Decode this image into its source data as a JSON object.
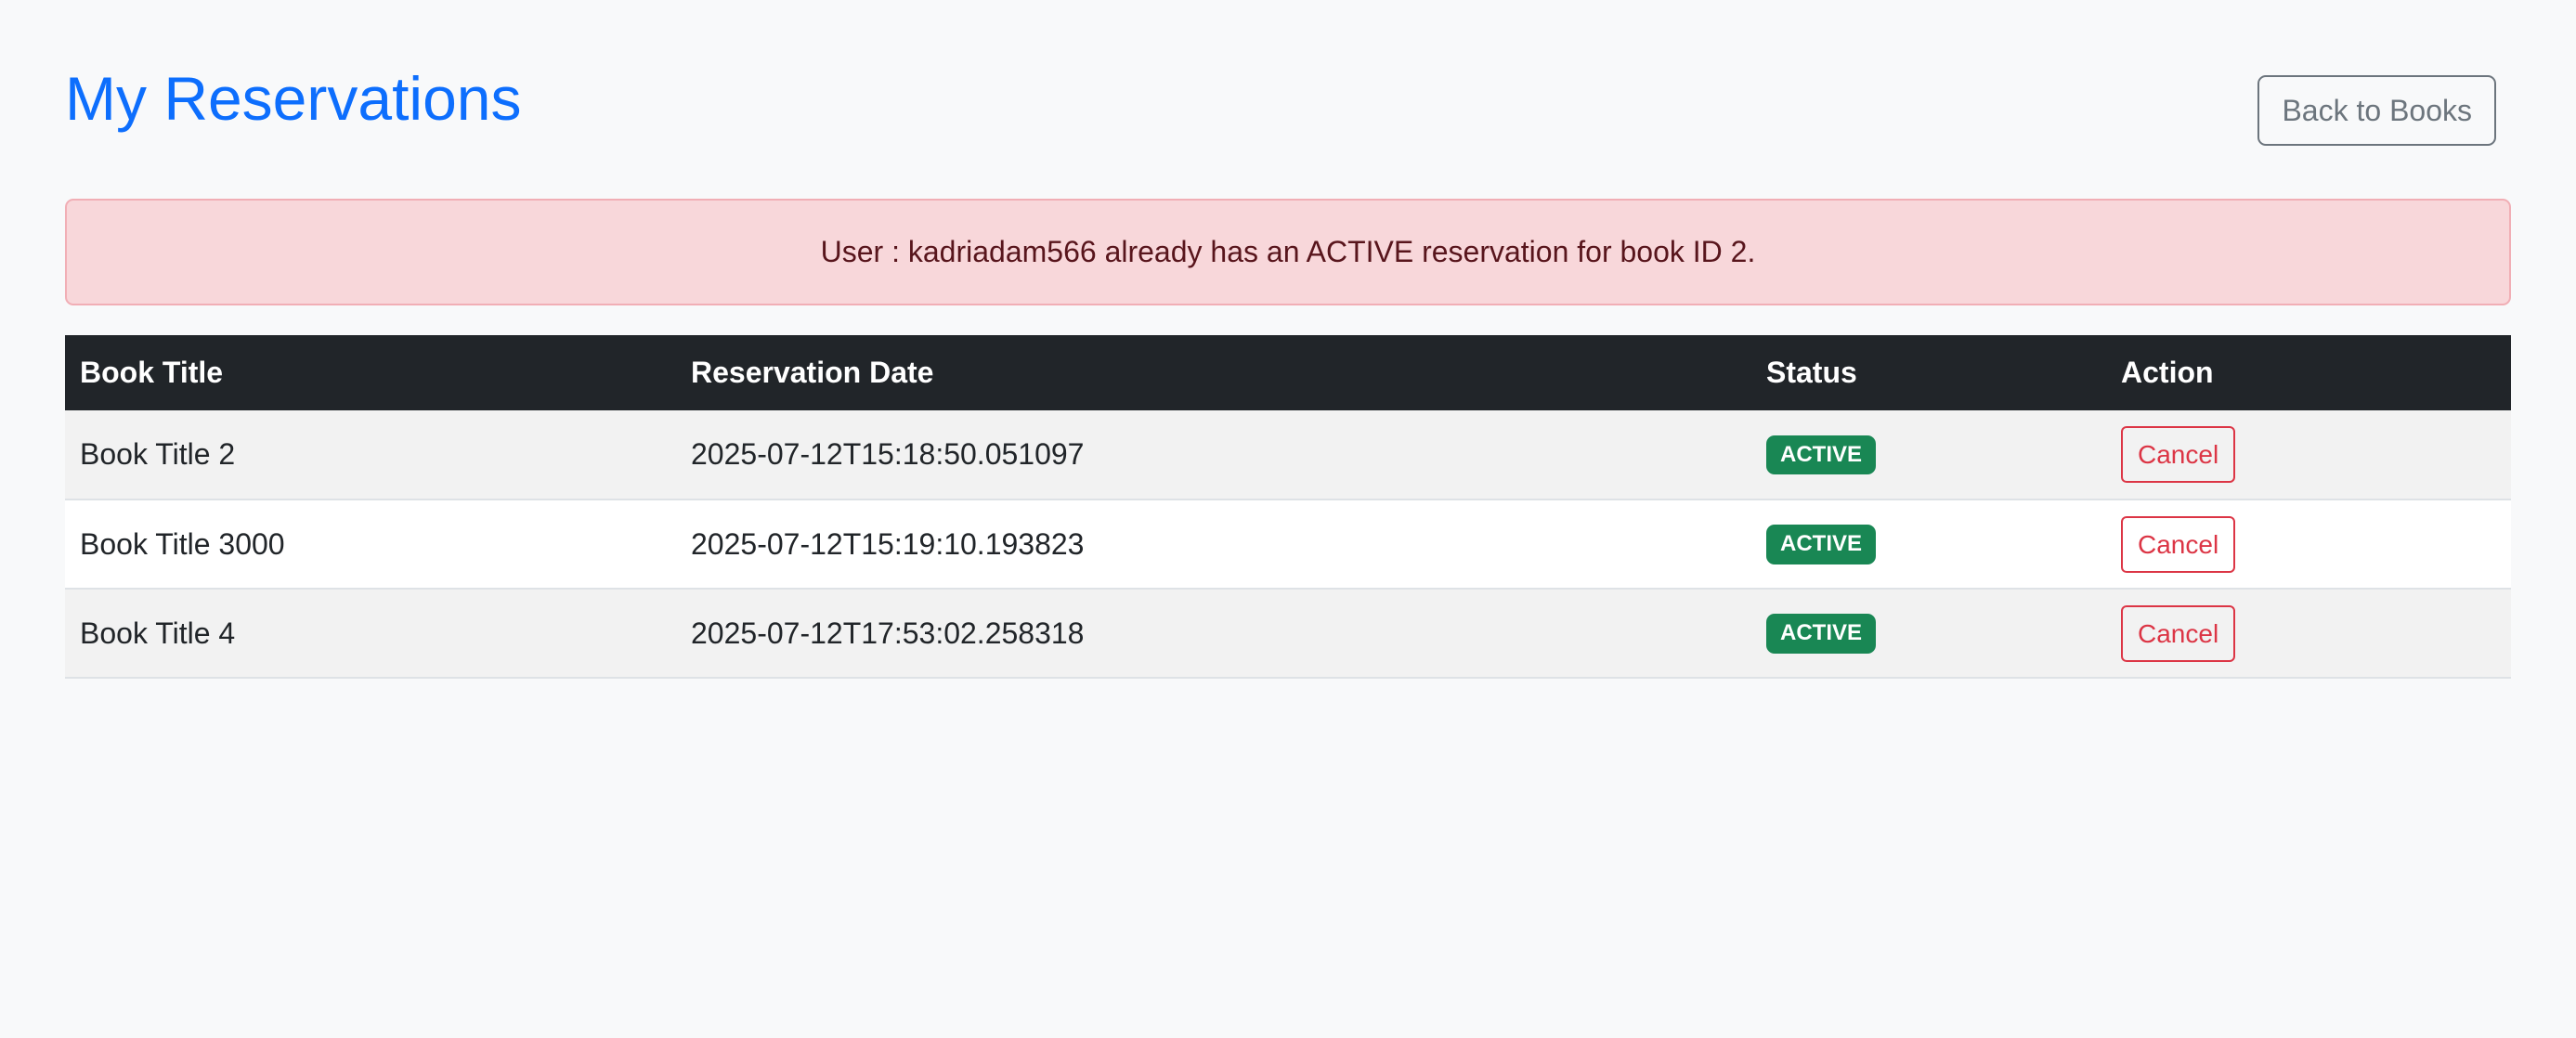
{
  "header": {
    "title": "My Reservations",
    "back_label": "Back to Books"
  },
  "alert": {
    "message": "User : kadriadam566 already has an ACTIVE reservation for book ID 2."
  },
  "table": {
    "columns": [
      "Book Title",
      "Reservation Date",
      "Status",
      "Action"
    ],
    "rows": [
      {
        "title": "Book Title 2",
        "date": "2025-07-12T15:18:50.051097",
        "status": "ACTIVE",
        "action": "Cancel"
      },
      {
        "title": "Book Title 3000",
        "date": "2025-07-12T15:19:10.193823",
        "status": "ACTIVE",
        "action": "Cancel"
      },
      {
        "title": "Book Title 4",
        "date": "2025-07-12T17:53:02.258318",
        "status": "ACTIVE",
        "action": "Cancel"
      }
    ]
  },
  "colors": {
    "title": "#0d6efd",
    "alert_bg": "#f8d7da",
    "alert_text": "#58151c",
    "header_bg": "#212529",
    "badge_active": "#198754",
    "danger": "#dc3545",
    "secondary": "#6c757d"
  }
}
